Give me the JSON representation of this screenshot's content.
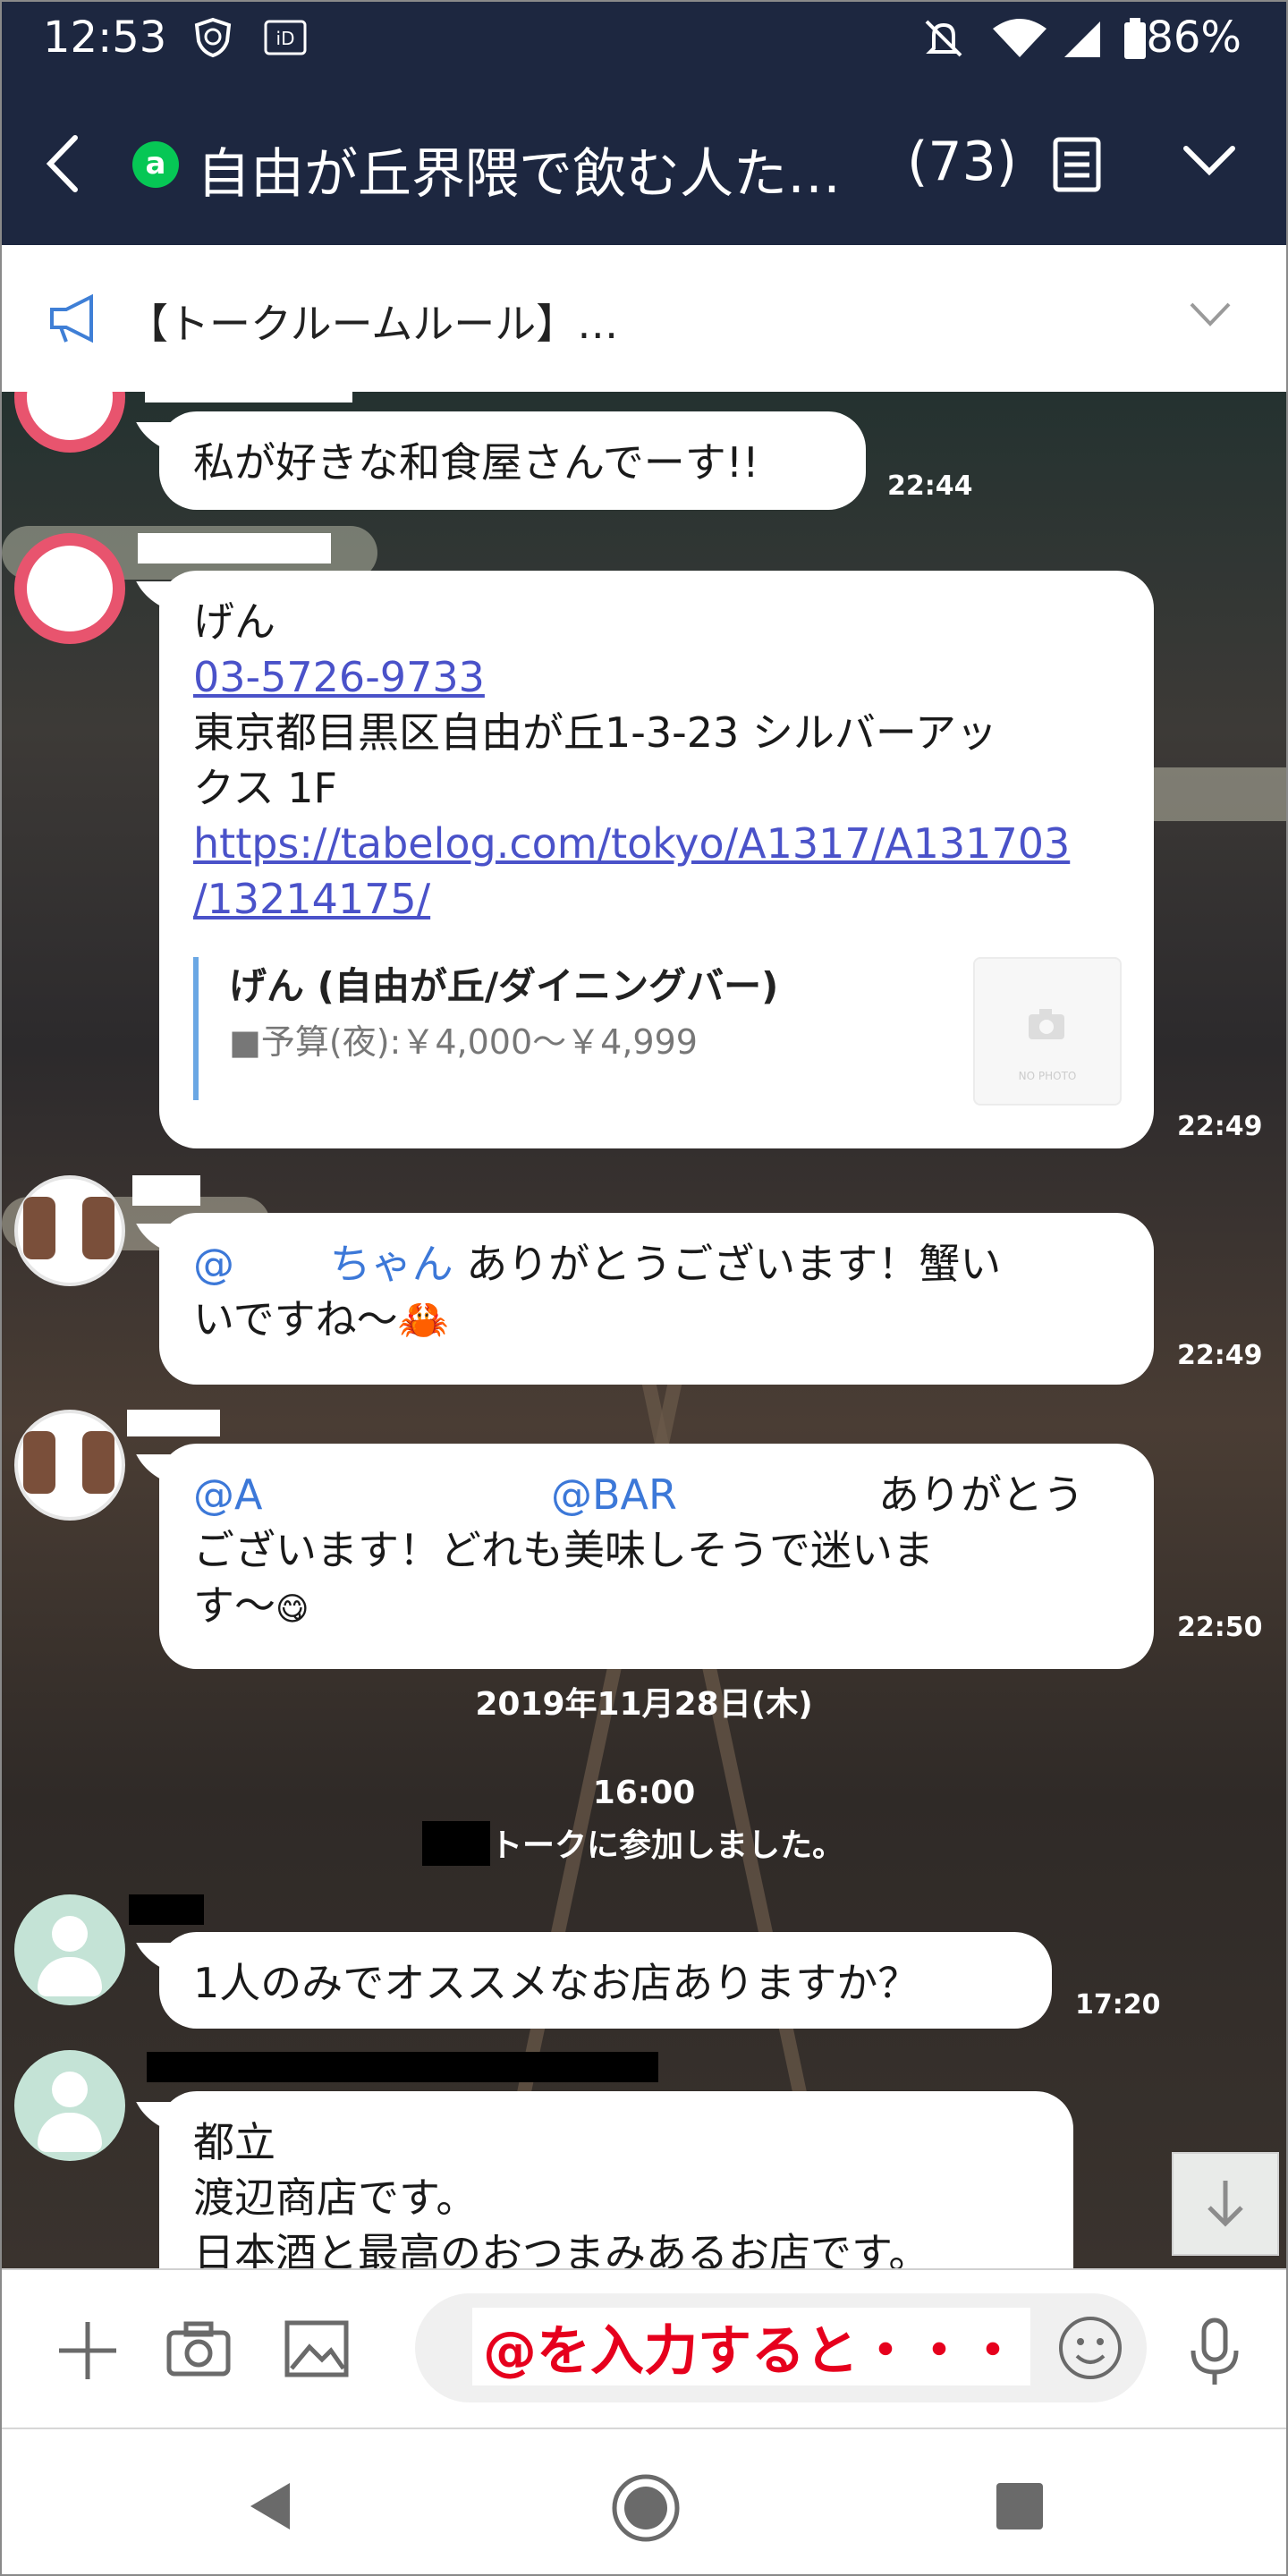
{
  "status_bar": {
    "time": "12:53",
    "battery": "86%"
  },
  "header": {
    "group_badge": "a",
    "title": "自由が丘界隈で飲む人た…",
    "member_count": "(73)"
  },
  "announcement": {
    "text": "【トークルームルール】…"
  },
  "messages": {
    "m1": {
      "text": "私が好きな和食屋さんでーす!!",
      "time": "22:44"
    },
    "m2": {
      "name_line": "げん",
      "phone": "03-5726-9733",
      "address": [
        "東京都目黒区自由が丘1-3-23 シルバーアッ",
        "クス 1F"
      ],
      "url": [
        "https://tabelog.com/tokyo/A1317/A131703",
        "/13214175/"
      ],
      "preview_title": "げん (自由が丘/ダイニングバー)",
      "preview_sub": "■予算(夜):￥4,000～￥4,999",
      "preview_thumb": "NO PHOTO",
      "time": "22:49"
    },
    "m3": {
      "mention": "@　　 ちゃん",
      "text_1": " ありがとうございます！蟹い",
      "text_2": "いですね〜",
      "emoji": "🦀",
      "time": "22:49"
    },
    "m4": {
      "mention_1": "@A",
      "mention_2": "@BAR",
      "text_1": "ありがとう",
      "text_2": "ございます！どれも美味しそうで迷いま",
      "text_3": "す〜",
      "emoji": "😋",
      "time": "22:50"
    },
    "date_divider": "2019年11月28日(木)",
    "system_time": "16:00",
    "system_join": "トークに参加しました。",
    "m5": {
      "text": "1人のみでオススメなお店ありますか？",
      "time": "17:20"
    },
    "m6": {
      "line_1": "都立",
      "line_2": "渡辺商店です。",
      "line_3": "日本酒と最高のおつまみあるお店です。"
    }
  },
  "input_bar": {
    "text": "@を入力すると・・・"
  },
  "colors": {
    "header_bg": "#1d2740",
    "line_green": "#06c755",
    "link": "#4a52c9",
    "mention": "#3c78d8",
    "annotation_red": "#e6001d"
  }
}
